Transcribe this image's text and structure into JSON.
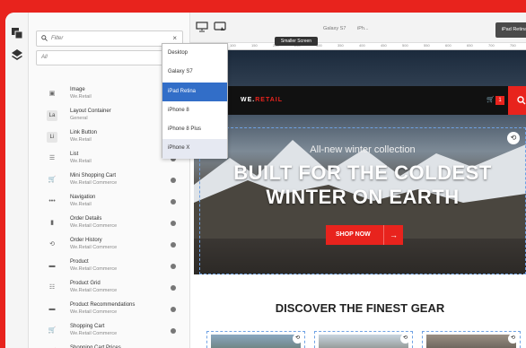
{
  "rail": {
    "icons": [
      "component-browser-icon",
      "layers-icon"
    ]
  },
  "panel": {
    "filter_placeholder": "Filter",
    "filter_clear": "×",
    "group_select": "All",
    "components": [
      {
        "title": "Image",
        "group": "We.Retail",
        "icon": "image-icon",
        "glyph": "▣",
        "box": false,
        "info": false
      },
      {
        "title": "Layout Container",
        "group": "General",
        "icon": "layout-container-icon",
        "glyph": "La",
        "box": true,
        "info": false
      },
      {
        "title": "Link Button",
        "group": "We.Retail",
        "icon": "link-button-icon",
        "glyph": "Li",
        "box": true,
        "info": false
      },
      {
        "title": "List",
        "group": "We.Retail",
        "icon": "list-icon",
        "glyph": "☰",
        "box": false,
        "info": true
      },
      {
        "title": "Mini Shopping Cart",
        "group": "We.Retail Commerce",
        "icon": "cart-icon",
        "glyph": "🛒",
        "box": false,
        "info": true
      },
      {
        "title": "Navigation",
        "group": "We.Retail",
        "icon": "more-icon",
        "glyph": "•••",
        "box": false,
        "info": true
      },
      {
        "title": "Order Details",
        "group": "We.Retail Commerce",
        "icon": "bag-icon",
        "glyph": "▮",
        "box": false,
        "info": true
      },
      {
        "title": "Order History",
        "group": "We.Retail Commerce",
        "icon": "history-icon",
        "glyph": "⟲",
        "box": false,
        "info": true
      },
      {
        "title": "Product",
        "group": "We.Retail Commerce",
        "icon": "product-icon",
        "glyph": "▬",
        "box": false,
        "info": true
      },
      {
        "title": "Product Grid",
        "group": "We.Retail Commerce",
        "icon": "grid-list-icon",
        "glyph": "☷",
        "box": false,
        "info": true
      },
      {
        "title": "Product Recommendations",
        "group": "We.Retail Commerce",
        "icon": "product-icon",
        "glyph": "▬",
        "box": false,
        "info": true
      },
      {
        "title": "Shopping Cart",
        "group": "We.Retail Commerce",
        "icon": "cart-icon",
        "glyph": "🛒",
        "box": false,
        "info": true
      },
      {
        "title": "Shopping Cart Prices",
        "group": "",
        "icon": "cart-icon",
        "glyph": "🛒",
        "box": false,
        "info": false
      }
    ]
  },
  "toolbar": {
    "devices": [
      "Galaxy S7",
      "iPh..."
    ],
    "active_device": "iPad Retina",
    "tooltip": "Smaller Screen"
  },
  "ruler": [
    "100",
    "150",
    "200",
    "250",
    "300",
    "350",
    "400",
    "450",
    "500",
    "550",
    "600",
    "650",
    "700",
    "750"
  ],
  "device_menu": {
    "options": [
      "Desktop",
      "Galaxy S7",
      "iPad Retina",
      "iPhone 8",
      "iPhone 8 Plus",
      "iPhone X"
    ],
    "selected": "iPad Retina",
    "hovered": "iPhone X"
  },
  "site": {
    "logo_main": "WE.",
    "logo_accent": "RETAIL",
    "cart_count": "1",
    "hero_sub": "All-new winter collection",
    "hero_title_1": "BUILT FOR THE COLDEST",
    "hero_title_2": "WINTER ON EARTH",
    "cta": "SHOP NOW",
    "cta_arrow": "→",
    "discover": "DISCOVER THE FINEST GEAR"
  },
  "colors": {
    "brand_red": "#e8231d",
    "selection_blue": "#326ec8",
    "outline_blue": "#6fa2e4"
  }
}
